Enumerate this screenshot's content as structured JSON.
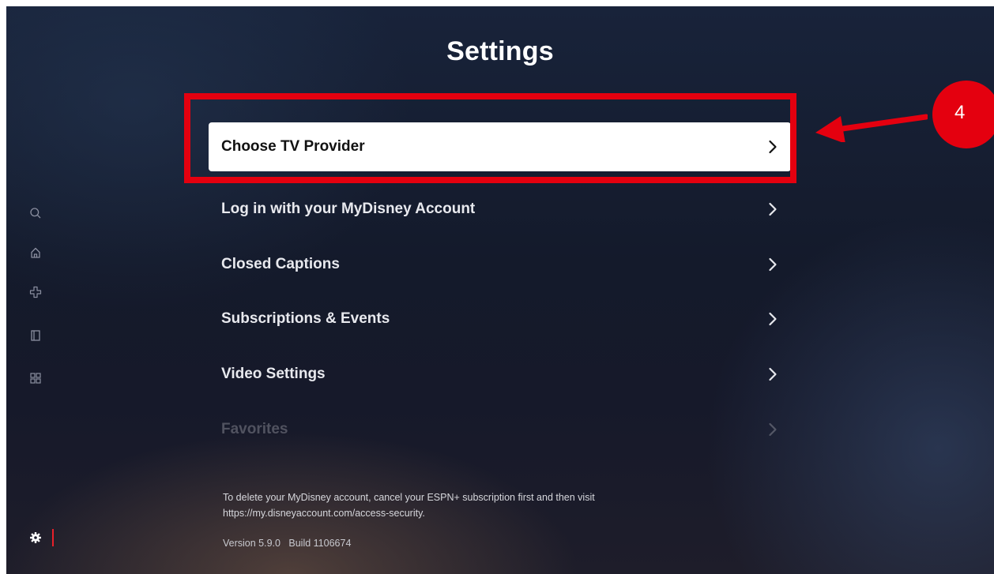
{
  "page": {
    "title": "Settings"
  },
  "sidebar": {
    "icons": [
      "search-icon",
      "home-icon",
      "plus-cross-icon",
      "library-icon",
      "grid-icon",
      "gear-icon"
    ],
    "active_color": "#e8202a"
  },
  "menu": {
    "items": [
      {
        "label": "Choose TV Provider",
        "focused": true
      },
      {
        "label": "Log in with your MyDisney Account"
      },
      {
        "label": "Closed Captions"
      },
      {
        "label": "Subscriptions & Events"
      },
      {
        "label": "Video Settings"
      },
      {
        "label": "Favorites",
        "faded": true
      }
    ]
  },
  "footer": {
    "note_line1": "To delete your MyDisney account, cancel your ESPN+ subscription first and then visit",
    "note_line2": "https://my.disneyaccount.com/access-security.",
    "version": "Version 5.9.0   Build 1106674"
  },
  "annotation": {
    "step_number": "4",
    "highlight_color": "#e4000f"
  }
}
